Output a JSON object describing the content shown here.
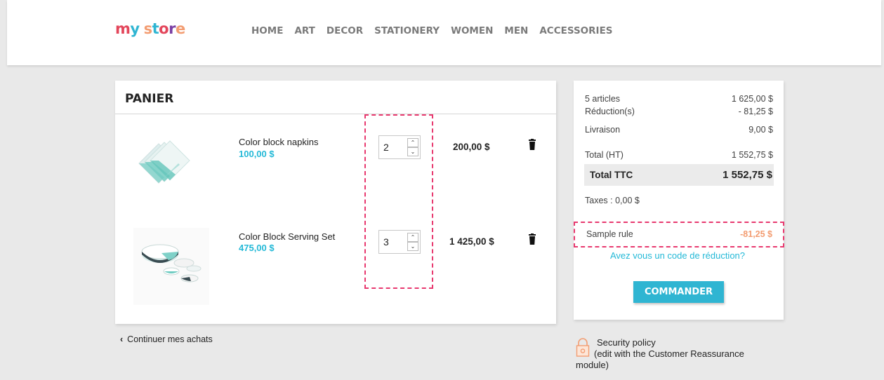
{
  "header": {
    "logo": {
      "letters": [
        "m",
        "y",
        " ",
        "s",
        "t",
        "o",
        "r",
        "e"
      ],
      "colors": [
        "#e3465b",
        "#2fb5d2",
        "#ffffff",
        "#f39d72",
        "#2fb5d2",
        "#e3465b",
        "#7a3ea3",
        "#f39d72"
      ]
    },
    "nav": [
      "HOME",
      "ART",
      "DECOR",
      "STATIONERY",
      "WOMEN",
      "MEN",
      "ACCESSORIES"
    ]
  },
  "cart": {
    "title": "PANIER",
    "items": [
      {
        "name": "Color block napkins",
        "unit_price": "100,00 $",
        "quantity": "2",
        "line_total": "200,00 $",
        "image_icon": "napkins-image"
      },
      {
        "name": "Color Block Serving Set",
        "unit_price": "475,00 $",
        "quantity": "3",
        "line_total": "1 425,00 $",
        "image_icon": "serving-set-image"
      }
    ],
    "continue_label": "Continuer mes achats"
  },
  "summary": {
    "articles_label": "5 articles",
    "articles_value": "1 625,00 $",
    "discount_label": "Réduction(s)",
    "discount_value": "- 81,25 $",
    "shipping_label": "Livraison",
    "shipping_value": "9,00 $",
    "total_ht_label": "Total (HT)",
    "total_ht_value": "1 552,75 $",
    "total_ttc_label": "Total TTC",
    "total_ttc_value": "1 552,75 $",
    "taxes": "Taxes : 0,00 $",
    "rule_name": "Sample rule",
    "rule_amount": "-81,25 $",
    "promo_link": "Avez vous un code de réduction?",
    "order_button": "COMMANDER"
  },
  "reassurance": {
    "line1": "Security policy",
    "line2": "(edit with the Customer Reassurance",
    "line3": "module)"
  },
  "colors": {
    "accent": "#2fb5d2",
    "highlight": "#e8396f",
    "discount": "#f39d72"
  }
}
